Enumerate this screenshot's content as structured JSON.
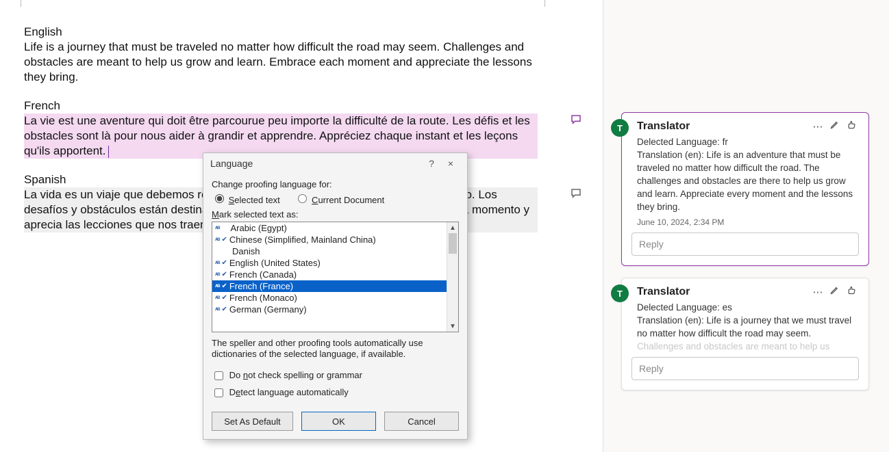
{
  "document": {
    "english_heading": "English",
    "english_body": "Life is a journey that must be traveled no matter how difficult the road may seem. Challenges and obstacles are meant to help us grow and learn. Embrace each moment and appreciate the lessons they bring.",
    "french_heading": "French",
    "french_body": "La vie est une aventure qui doit être parcourue peu importe la difficulté de la route. Les défis et les obstacles sont là pour nous aider à grandir et apprendre. Appréciez chaque instant et les leçons qu'ils apportent.",
    "spanish_heading": "Spanish",
    "spanish_body": "La vida es un viaje que debemos recorrer sin importar qué tan difícil parezca el camino. Los desafíos y obstáculos están destinados a ayudarnos a crecer y aprender. Acepta cada momento y aprecia las lecciones que nos traen."
  },
  "dialog": {
    "title": "Language",
    "help": "?",
    "close": "×",
    "change_label": "Change proofing language for:",
    "radio_selected": "Selected text",
    "radio_document": "Current Document",
    "mark_label": "Mark selected text as:",
    "languages": [
      {
        "text": "Arabic (Egypt)",
        "abc": true,
        "check": false,
        "selected": false
      },
      {
        "text": "Chinese (Simplified, Mainland China)",
        "abc": true,
        "check": true,
        "selected": false
      },
      {
        "text": "Danish",
        "abc": false,
        "check": false,
        "selected": false
      },
      {
        "text": "English (United States)",
        "abc": true,
        "check": true,
        "selected": false
      },
      {
        "text": "French (Canada)",
        "abc": true,
        "check": true,
        "selected": false
      },
      {
        "text": "French (France)",
        "abc": true,
        "check": true,
        "selected": true
      },
      {
        "text": "French (Monaco)",
        "abc": true,
        "check": true,
        "selected": false
      },
      {
        "text": "German (Germany)",
        "abc": true,
        "check": true,
        "selected": false
      }
    ],
    "help_text": "The speller and other proofing tools automatically use dictionaries of the selected language, if available.",
    "cb_nocheck": "Do not check spelling or grammar",
    "cb_detect": "Detect language automatically",
    "btn_default": "Set As Default",
    "btn_ok": "OK",
    "btn_cancel": "Cancel"
  },
  "comments": [
    {
      "author": "Translator",
      "initial": "T",
      "lines": [
        "Delected Language: fr",
        "Translation (en): Life is an adventure that must be traveled no matter how difficult the road. The challenges and obstacles are there to help us grow and learn. Appreciate every moment and the lessons they bring."
      ],
      "time": "June 10, 2024, 2:34 PM",
      "reply_placeholder": "Reply",
      "active": true
    },
    {
      "author": "Translator",
      "initial": "T",
      "lines": [
        "Delected Language: es",
        "Translation (en): Life is a journey that we must travel no matter how difficult the road may seem. Challenges and obstacles are meant to help us"
      ],
      "time": "",
      "reply_placeholder": "Reply",
      "active": false
    }
  ]
}
